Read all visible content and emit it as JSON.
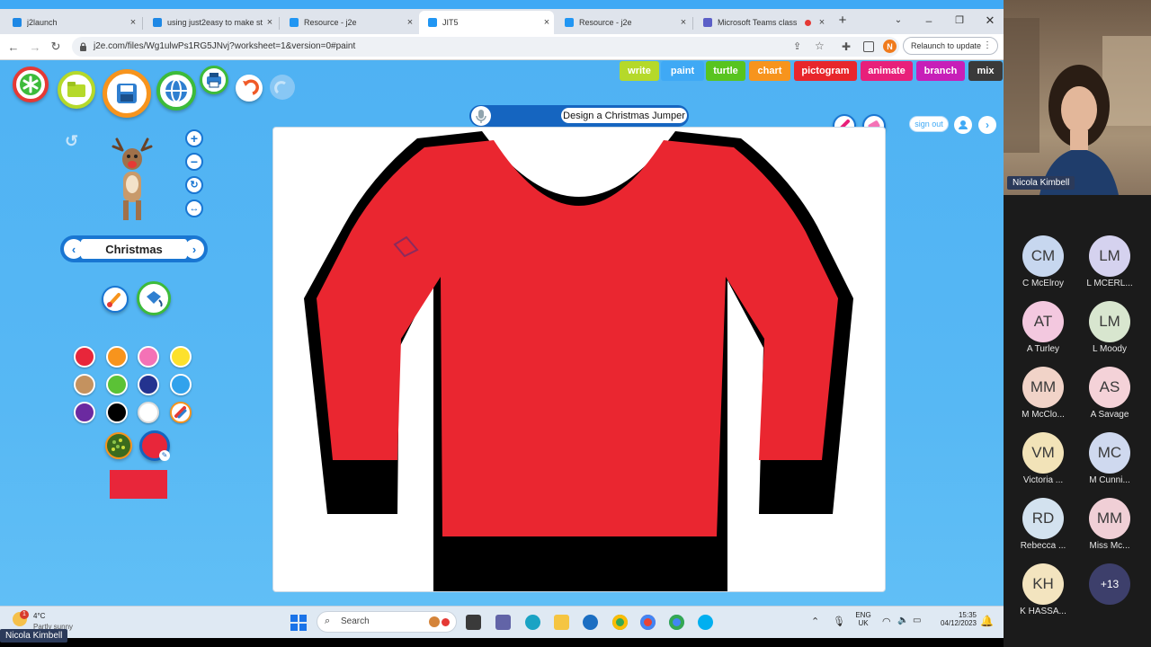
{
  "browser": {
    "tabs": [
      {
        "title": "j2launch",
        "favicon_color": "#1e88e5"
      },
      {
        "title": "using just2easy to make st",
        "favicon_color": "#1e88e5"
      },
      {
        "title": "Resource - j2e",
        "favicon_color": "#2196f3"
      },
      {
        "title": "JIT5",
        "favicon_color": "#2196f3"
      },
      {
        "title": "Resource - j2e",
        "favicon_color": "#2196f3"
      },
      {
        "title": "Microsoft Teams class",
        "favicon_color": "#5b5fc7"
      }
    ],
    "new_tab": "+",
    "url": "j2e.com/files/Wg1ulwPs1RG5JNvj?worksheet=1&version=0#paint",
    "relaunch_label": "Relaunch to update",
    "profile_initial": "N"
  },
  "app": {
    "modes": [
      {
        "label": "write",
        "color": "#b5d92a"
      },
      {
        "label": "paint",
        "color": "#3fa9f5"
      },
      {
        "label": "turtle",
        "color": "#58c41f"
      },
      {
        "label": "chart",
        "color": "#f7941d"
      },
      {
        "label": "pictogram",
        "color": "#e8262b"
      },
      {
        "label": "animate",
        "color": "#e8207a"
      },
      {
        "label": "branch",
        "color": "#c71fb8"
      },
      {
        "label": "mix",
        "color": "#3a3a3a"
      }
    ],
    "document_title": "Design a Christmas Jumper",
    "sign_out_label": "sign out",
    "stamp_category": "Christmas",
    "palette": [
      "#e8263a",
      "#f7941d",
      "#f472b6",
      "#fde12c",
      "#c4925f",
      "#5bc236",
      "#24338f",
      "#31a2ec",
      "#6b2aa0",
      "#000000",
      "#ffffff"
    ],
    "fill_color": "#e8263a",
    "jumper_color": "#ea2630"
  },
  "taskbar": {
    "weather_temp": "4°C",
    "weather_desc": "Partly sunny",
    "weather_badge": "1",
    "search_placeholder": "Search",
    "language": "ENG",
    "region": "UK",
    "time": "15:35",
    "date": "04/12/2023"
  },
  "teams": {
    "presenter": "Nicola Kimbell",
    "participants": [
      {
        "initials": "CM",
        "name": "C McElroy"
      },
      {
        "initials": "LM",
        "name": "L MCERL..."
      },
      {
        "initials": "AT",
        "name": "A Turley"
      },
      {
        "initials": "LM",
        "name": "L Moody"
      },
      {
        "initials": "MM",
        "name": "M McClo..."
      },
      {
        "initials": "AS",
        "name": "A Savage"
      },
      {
        "initials": "VM",
        "name": "Victoria ..."
      },
      {
        "initials": "MC",
        "name": "M Cunni..."
      },
      {
        "initials": "RD",
        "name": "Rebecca ..."
      },
      {
        "initials": "MM",
        "name": "Miss Mc..."
      },
      {
        "initials": "KH",
        "name": "K HASSA..."
      }
    ],
    "more_count": "+13",
    "self_name": "Nicola Kimbell"
  }
}
